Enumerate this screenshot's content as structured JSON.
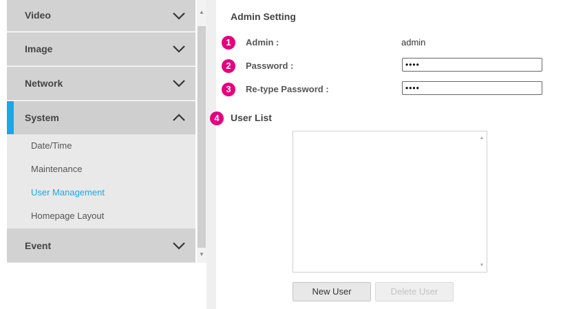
{
  "sidebar": {
    "sections": {
      "video": {
        "label": "Video"
      },
      "image": {
        "label": "Image"
      },
      "network": {
        "label": "Network"
      },
      "system": {
        "label": "System"
      },
      "event": {
        "label": "Event"
      }
    },
    "system_items": [
      "Date/Time",
      "Maintenance",
      "User Management",
      "Homepage Layout"
    ],
    "active_item": "User Management"
  },
  "admin_setting": {
    "title": "Admin Setting",
    "admin_label": "Admin :",
    "admin_value": "admin",
    "password_label": "Password :",
    "password_value": "••••",
    "retype_label": "Re-type Password :",
    "retype_value": "••••"
  },
  "user_list": {
    "title": "User List",
    "items": [],
    "new_user_label": "New User",
    "delete_user_label": "Delete User"
  },
  "badges": [
    "1",
    "2",
    "3",
    "4"
  ],
  "colors": {
    "accent": "#1aa7e5",
    "badge": "#e6007e",
    "sidebar_header": "#d2d2d2",
    "sidebar_sub_bg": "#e9e9e9"
  }
}
